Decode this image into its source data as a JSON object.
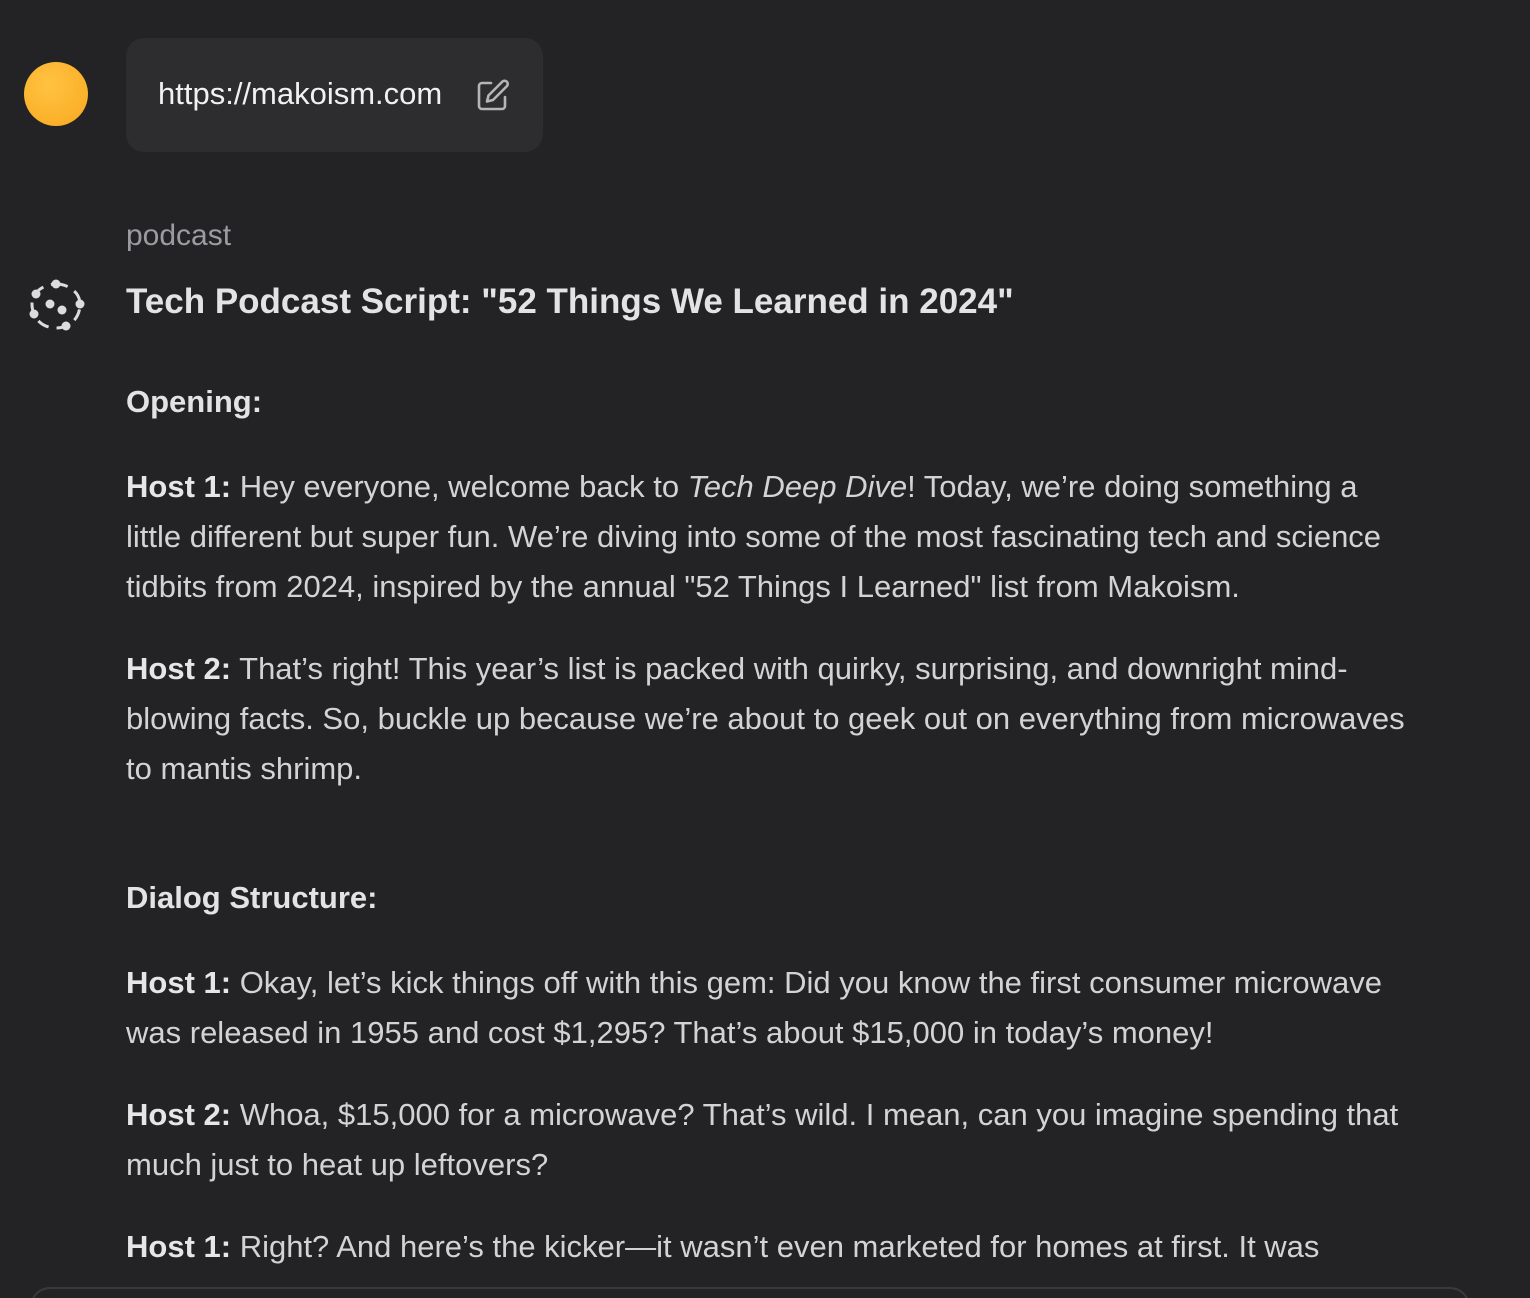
{
  "user_message": {
    "url": "https://makoism.com",
    "avatar_color": "#fbb02a"
  },
  "assistant": {
    "model_label": "podcast",
    "title": "Tech Podcast Script: \"52 Things We Learned in 2024\"",
    "sections": {
      "opening": "Opening:",
      "dialog": "Dialog Structure:"
    },
    "lines": [
      {
        "speaker": "Host 1:",
        "pre": " Hey everyone, welcome back to ",
        "emph": "Tech Deep Dive",
        "post": "! Today, we’re doing something a little different but super fun. We’re diving into some of the most fascinating tech and science tidbits from 2024, inspired by the annual \"52 Things I Learned\" list from Makoism."
      },
      {
        "speaker": "Host 2:",
        "text": " That’s right! This year’s list is packed with quirky, surprising, and downright mind-blowing facts. So, buckle up because we’re about to geek out on everything from microwaves to mantis shrimp."
      },
      {
        "speaker": "Host 1:",
        "text": " Okay, let’s kick things off with this gem: Did you know the first consumer microwave was released in 1955 and cost $1,295? That’s about $15,000 in today’s money!"
      },
      {
        "speaker": "Host 2:",
        "text": " Whoa, $15,000 for a microwave? That’s wild. I mean, can you imagine spending that much just to heat up leftovers?"
      },
      {
        "speaker": "Host 1:",
        "text": " Right? And here’s the kicker—it wasn’t even marketed for homes at first. It was"
      }
    ]
  }
}
